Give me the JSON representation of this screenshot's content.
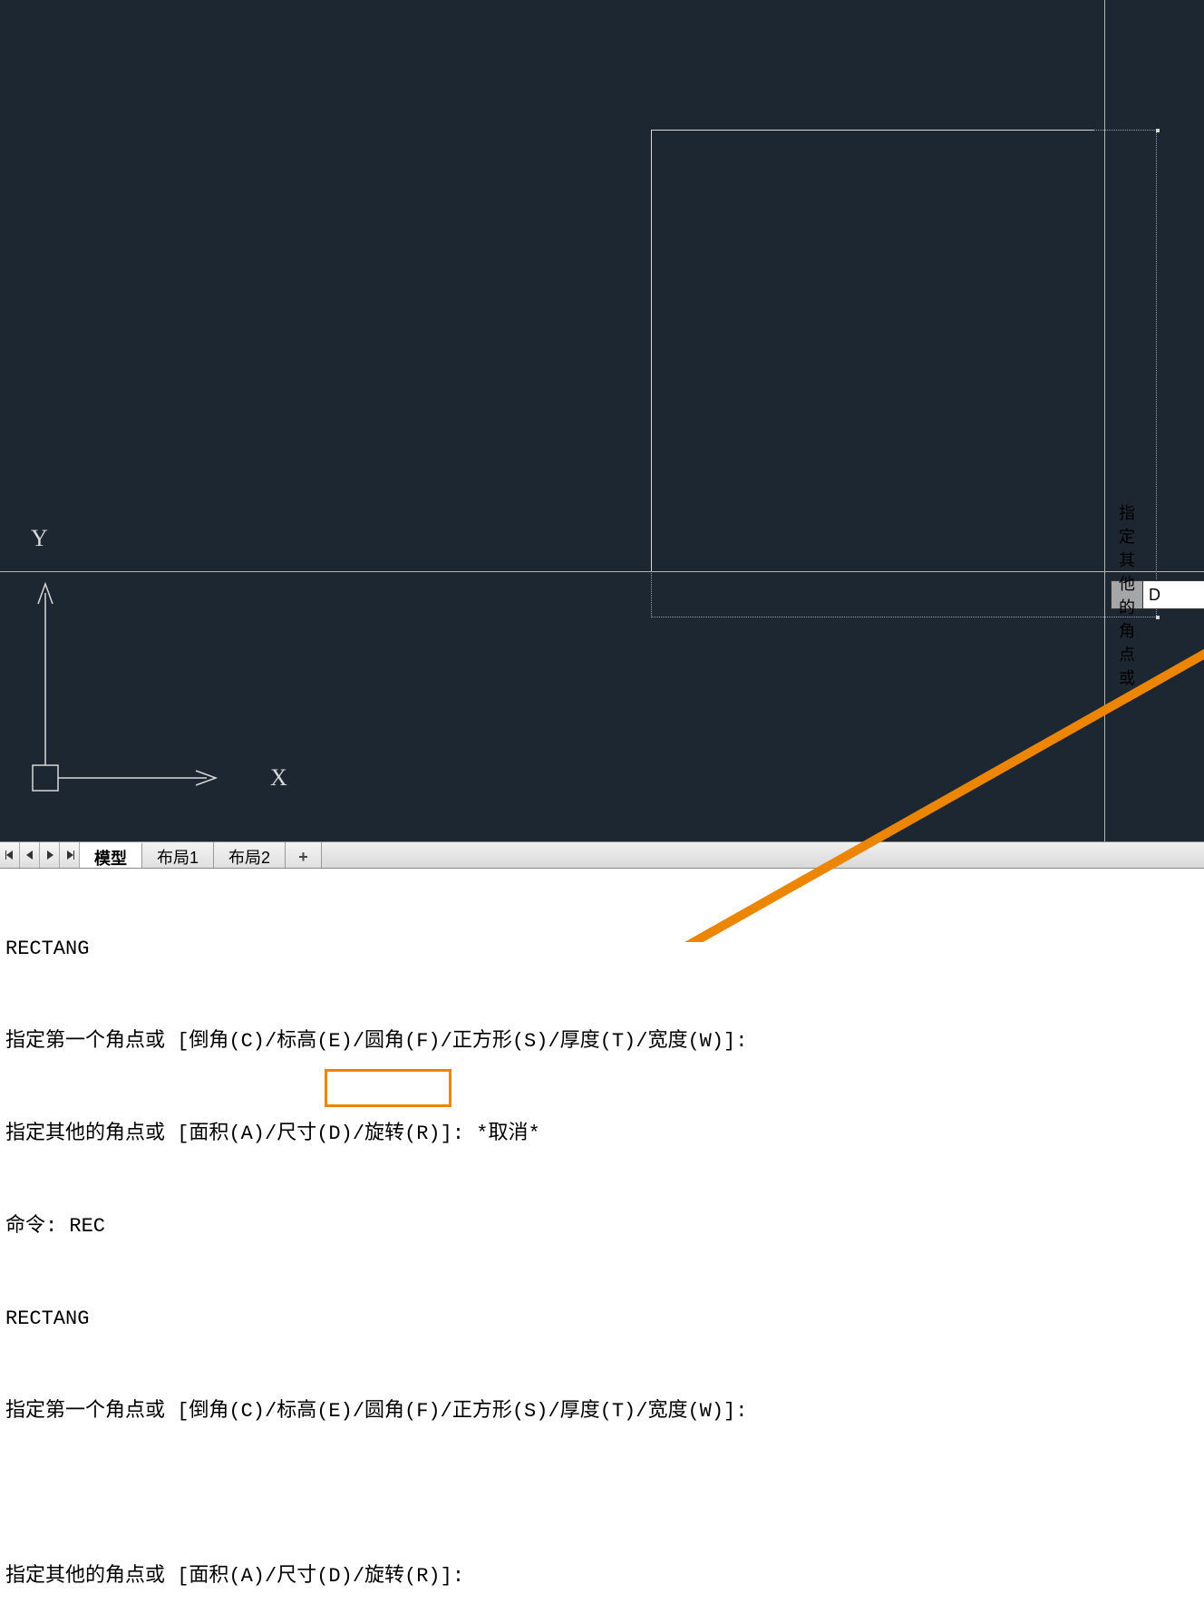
{
  "dynamic_input": {
    "prompt": "指定其他的角点或",
    "value": "D"
  },
  "ucs": {
    "x_label": "X",
    "y_label": "Y"
  },
  "tabs": {
    "model": "模型",
    "layout1": "布局1",
    "layout2": "布局2"
  },
  "command_history": {
    "line1": "RECTANG",
    "line2": "指定第一个角点或 [倒角(C)/标高(E)/圆角(F)/正方形(S)/厚度(T)/宽度(W)]:",
    "line3": "指定其他的角点或 [面积(A)/尺寸(D)/旋转(R)]: *取消*",
    "line4": "命令: REC",
    "line5": "RECTANG",
    "line6": "指定第一个角点或 [倒角(C)/标高(E)/圆角(F)/正方形(S)/厚度(T)/宽度(W)]:",
    "line7": "指定其他的角点或 [面积(A)/尺寸(D)/旋转(R)]:"
  }
}
